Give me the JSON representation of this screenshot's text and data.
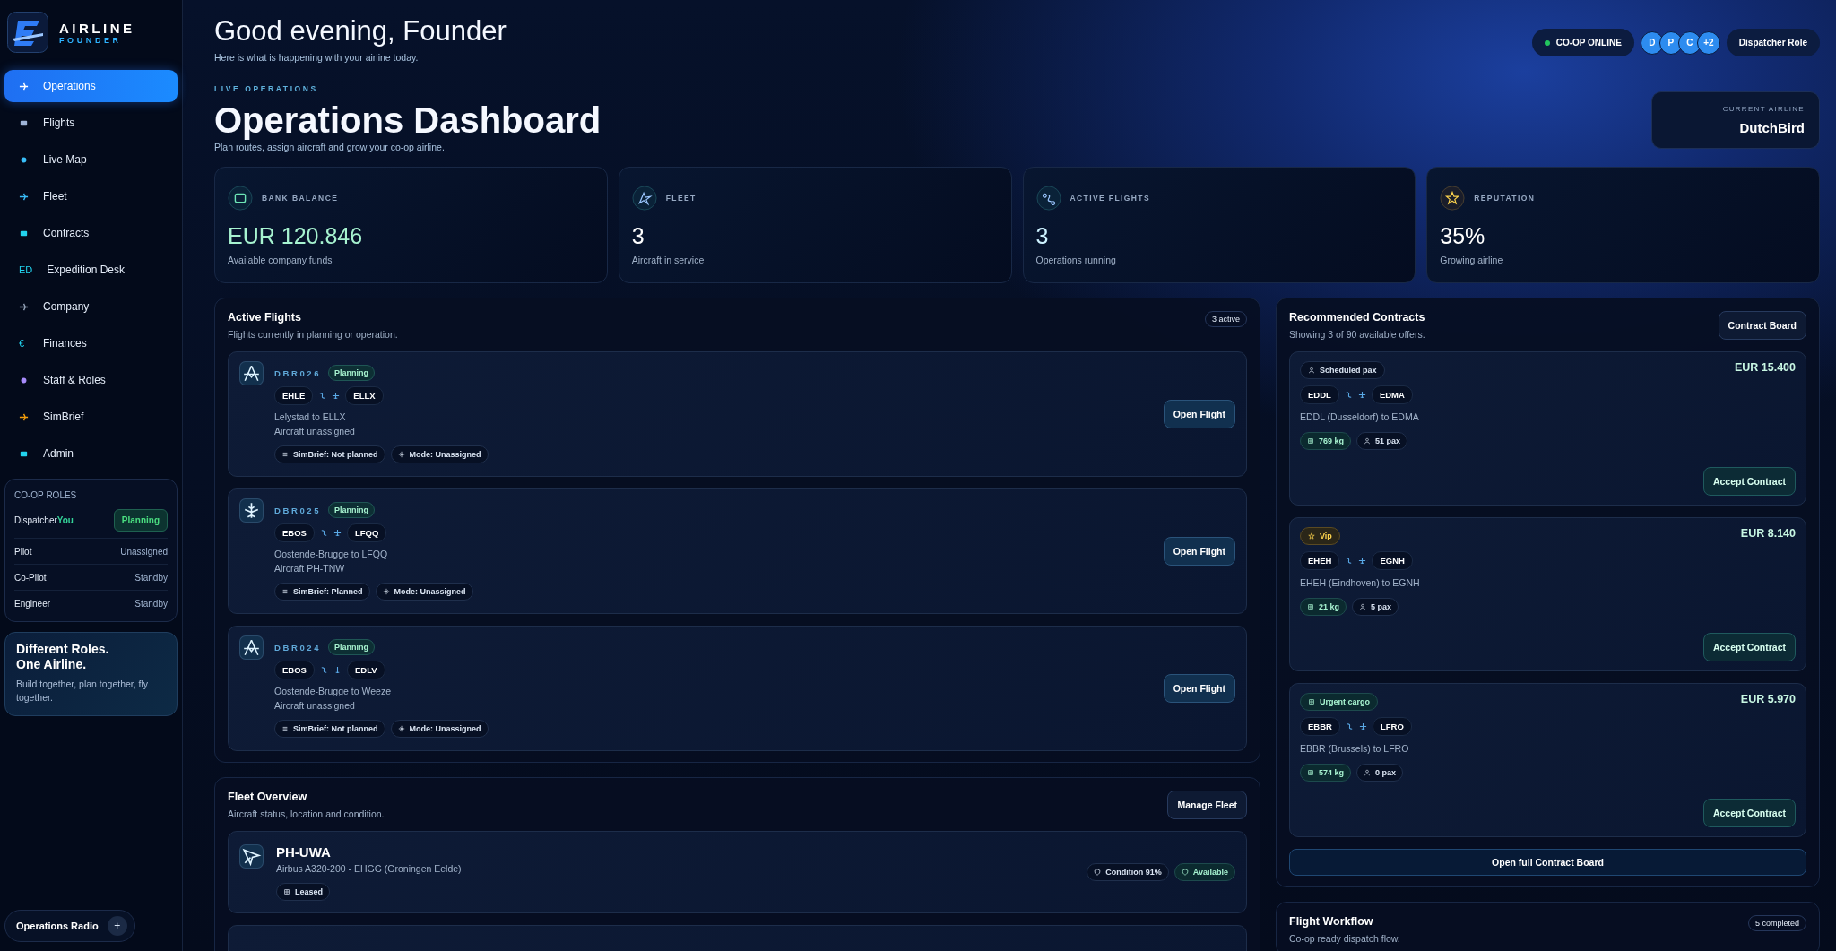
{
  "brand": {
    "line1": "AIRLINE",
    "line2": "FOUNDER"
  },
  "nav": [
    {
      "label": "Operations",
      "selected": true
    },
    {
      "label": "Flights",
      "selected": false
    },
    {
      "label": "Live Map",
      "selected": false
    },
    {
      "label": "Fleet",
      "selected": false
    },
    {
      "label": "Contracts",
      "selected": false
    },
    {
      "label": "Expedition Desk",
      "glyph": "ED",
      "selected": false
    },
    {
      "label": "Company",
      "selected": false
    },
    {
      "label": "Finances",
      "glyph": "€",
      "selected": false
    },
    {
      "label": "Staff & Roles",
      "selected": false
    },
    {
      "label": "SimBrief",
      "selected": false
    },
    {
      "label": "Admin",
      "selected": false
    }
  ],
  "coop_roles": {
    "title": "CO-OP ROLES",
    "rows": [
      {
        "role": "Dispatcher",
        "you": "You",
        "status": "Planning",
        "kind": "badge"
      },
      {
        "role": "Pilot",
        "status": "Unassigned",
        "kind": "plain"
      },
      {
        "role": "Co-Pilot",
        "status": "Standby",
        "kind": "plain"
      },
      {
        "role": "Engineer",
        "status": "Standby",
        "kind": "plain"
      }
    ]
  },
  "promo": {
    "title_lines": [
      "Different Roles.",
      "One Airline."
    ],
    "text": "Build together, plan together, fly together."
  },
  "radio": {
    "label": "Operations Radio",
    "button": "+"
  },
  "header": {
    "greeting": "Good evening, Founder",
    "subtitle": "Here is what is happening with your airline today.",
    "status": "CO-OP ONLINE",
    "online": true,
    "avatars": [
      "D",
      "P",
      "C",
      "+2"
    ],
    "role_button": "Dispatcher Role"
  },
  "page": {
    "eyebrow": "LIVE OPERATIONS",
    "title": "Operations Dashboard",
    "subtitle": "Plan routes, assign aircraft and grow your co-op airline.",
    "airline_label": "CURRENT AIRLINE",
    "airline": "DutchBird"
  },
  "stats": [
    {
      "kind": "wallet",
      "label": "BANK BALANCE",
      "value": "EUR 120.846",
      "sub": "Available company funds"
    },
    {
      "kind": "fleet",
      "label": "FLEET",
      "value": "3",
      "sub": "Aircraft in service"
    },
    {
      "kind": "flights",
      "label": "ACTIVE FLIGHTS",
      "value": "3",
      "sub": "Operations running"
    },
    {
      "kind": "reputation",
      "label": "REPUTATION",
      "value": "35%",
      "sub": "Growing airline"
    }
  ],
  "active_flights": {
    "title": "Active Flights",
    "subtitle": "Flights currently in planning or operation.",
    "count": "3 active",
    "flights": [
      {
        "code": "DBR026",
        "status": "Planning",
        "from": "EHLE",
        "to": "ELLX",
        "route": "Lelystad to ELLX",
        "aircraft": "Aircraft unassigned",
        "simbrief": "SimBrief: Not planned",
        "mode": "Mode: Unassigned",
        "button": "Open Flight"
      },
      {
        "code": "DBR025",
        "status": "Planning",
        "from": "EBOS",
        "to": "LFQQ",
        "route": "Oostende-Brugge to LFQQ",
        "aircraft": "Aircraft PH-TNW",
        "simbrief": "SimBrief: Planned",
        "mode": "Mode: Unassigned",
        "button": "Open Flight"
      },
      {
        "code": "DBR024",
        "status": "Planning",
        "from": "EBOS",
        "to": "EDLV",
        "route": "Oostende-Brugge to Weeze",
        "aircraft": "Aircraft unassigned",
        "simbrief": "SimBrief: Not planned",
        "mode": "Mode: Unassigned",
        "button": "Open Flight"
      }
    ]
  },
  "fleet": {
    "title": "Fleet Overview",
    "subtitle": "Aircraft status, location and condition.",
    "button": "Manage Fleet",
    "aircraft": [
      {
        "reg": "PH-UWA",
        "detail": "Airbus A320-200 - EHGG (Groningen Eelde)",
        "tag": "Leased",
        "condition": "Condition 91%",
        "status": "Available"
      }
    ]
  },
  "contracts": {
    "title": "Recommended Contracts",
    "subtitle": "Showing 3 of 90 available offers.",
    "button": "Contract Board",
    "items": [
      {
        "kind": "pax",
        "type": "Scheduled pax",
        "price": "EUR 15.400",
        "from": "EDDL",
        "to": "EDMA",
        "route": "EDDL (Dusseldorf) to EDMA",
        "cargo": "769 kg",
        "pax": "51 pax",
        "button": "Accept Contract"
      },
      {
        "kind": "vip",
        "type": "Vip",
        "price": "EUR 8.140",
        "from": "EHEH",
        "to": "EGNH",
        "route": "EHEH (Eindhoven) to EGNH",
        "cargo": "21 kg",
        "pax": "5 pax",
        "button": "Accept Contract"
      },
      {
        "kind": "cargo",
        "type": "Urgent cargo",
        "price": "EUR 5.970",
        "from": "EBBR",
        "to": "LFRO",
        "route": "EBBR (Brussels) to LFRO",
        "cargo": "574 kg",
        "pax": "0 pax",
        "button": "Accept Contract"
      }
    ],
    "footer_button": "Open full Contract Board"
  },
  "workflow": {
    "title": "Flight Workflow",
    "count": "5 completed",
    "subtitle": "Co-op ready dispatch flow."
  }
}
